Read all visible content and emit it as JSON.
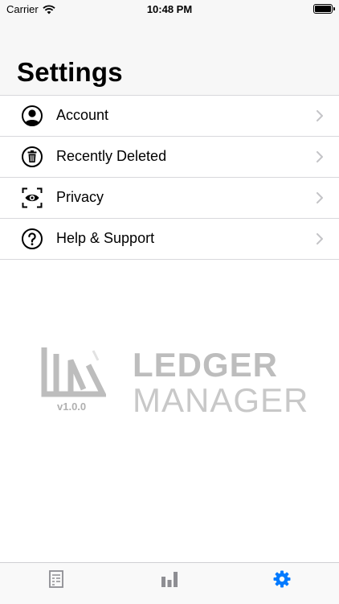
{
  "status_bar": {
    "carrier": "Carrier",
    "time": "10:48 PM"
  },
  "header": {
    "title": "Settings"
  },
  "settings_items": [
    {
      "label": "Account",
      "icon": "account-icon"
    },
    {
      "label": "Recently Deleted",
      "icon": "trash-icon"
    },
    {
      "label": "Privacy",
      "icon": "eye-icon"
    },
    {
      "label": "Help & Support",
      "icon": "help-icon"
    }
  ],
  "logo": {
    "word1": "LEDGER",
    "word2": "MANAGER",
    "version": "v1.0.0"
  },
  "tab_bar": {
    "tabs": [
      {
        "icon": "ledger-icon"
      },
      {
        "icon": "chart-icon"
      },
      {
        "icon": "settings-gear-icon",
        "active": true
      }
    ]
  },
  "colors": {
    "accent": "#007aff",
    "tab_inactive": "#8e8e93",
    "logo_gray": "#bdbdbd"
  }
}
